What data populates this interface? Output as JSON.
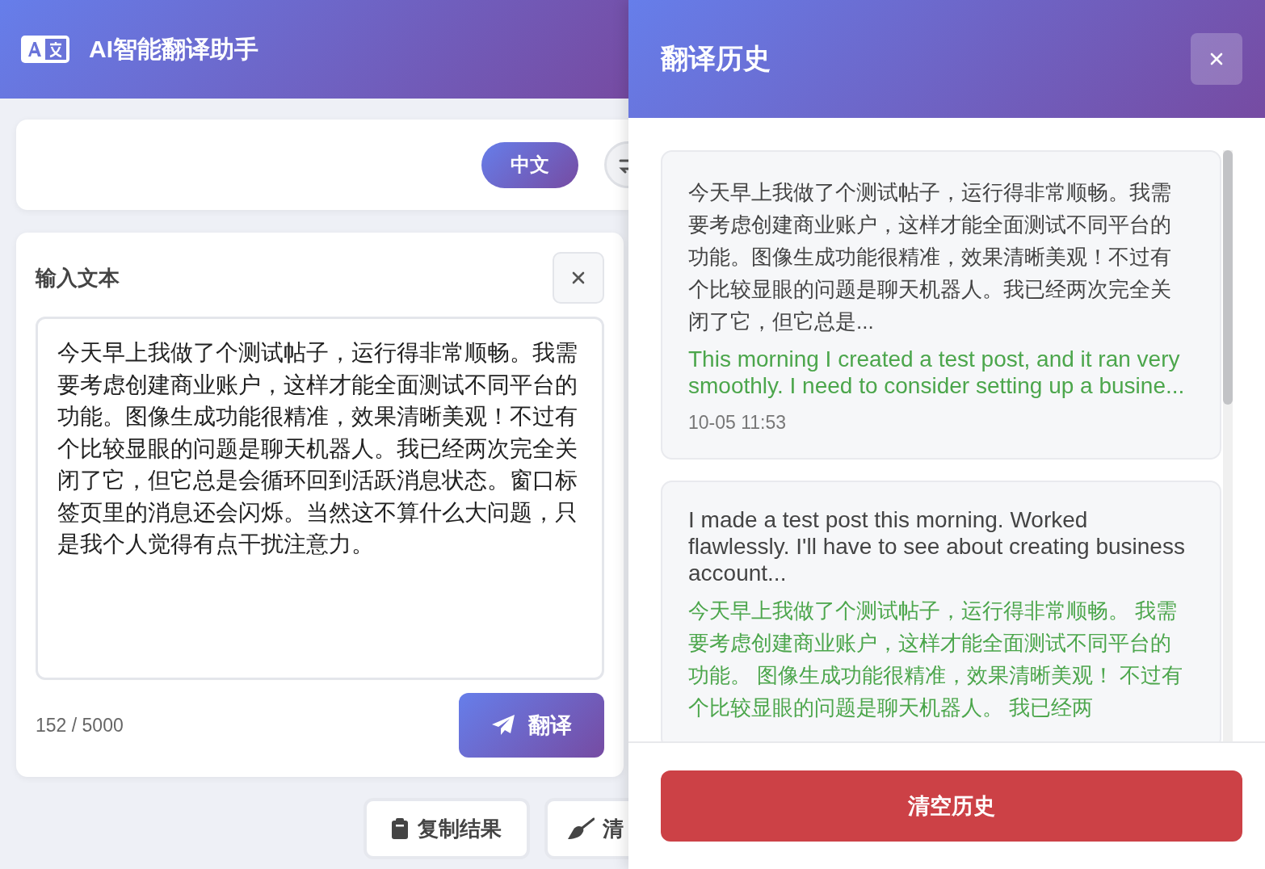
{
  "header": {
    "title": "AI智能翻译助手"
  },
  "language_bar": {
    "target_language": "中文"
  },
  "input": {
    "label": "输入文本",
    "value": "今天早上我做了个测试帖子，运行得非常顺畅。我需要考虑创建商业账户，这样才能全面测试不同平台的功能。图像生成功能很精准，效果清晰美观！不过有个比较显眼的问题是聊天机器人。我已经两次完全关闭了它，但它总是会循环回到活跃消息状态。窗口标签页里的消息还会闪烁。当然这不算什么大问题，只是我个人觉得有点干扰注意力。",
    "char_count": "152 / 5000",
    "translate_button": "翻译"
  },
  "actions": [
    {
      "label": "复制结果",
      "kind": "copy"
    },
    {
      "label": "清",
      "kind": "clear"
    }
  ],
  "history_panel": {
    "title": "翻译历史",
    "items": [
      {
        "source": "今天早上我做了个测试帖子，运行得非常顺畅。我需要考虑创建商业账户，这样才能全面测试不同平台的功能。图像生成功能很精准，效果清晰美观！不过有个比较显眼的问题是聊天机器人。我已经两次完全关闭了它，但它总是...",
        "translation": "This morning I created a test post, and it ran very smoothly. I need to consider setting up a busine...",
        "time": "10-05 11:53"
      },
      {
        "source": "I made a test post this morning. Worked flawlessly. I'll have to see about creating business account...",
        "translation": "今天早上我做了个测试帖子，运行得非常顺畅。 我需要考虑创建商业账户，这样才能全面测试不同平台的功能。 图像生成功能很精准，效果清晰美观！ 不过有个比较显眼的问题是聊天机器人。 我已经两"
      }
    ],
    "clear_button": "清空历史"
  }
}
